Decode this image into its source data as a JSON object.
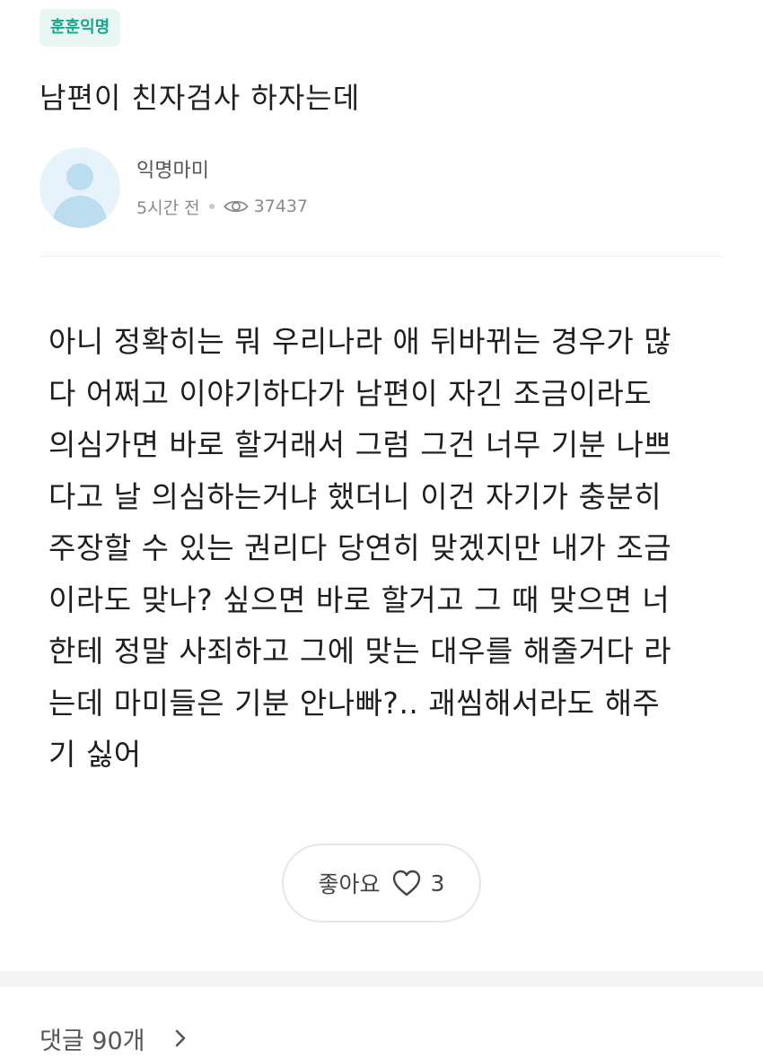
{
  "category": "훈훈익명",
  "post": {
    "title": "남편이 친자검사 하자는데",
    "author": "익명마미",
    "time": "5시간 전",
    "views": "37437",
    "body": "아니 정확히는 뭐 우리나라 애 뒤바뀌는 경우가 많\n다 어쩌고 이야기하다가 남편이 자긴 조금이라도\n의심가면 바로 할거래서 그럼 그건 너무 기분 나쁘\n다고 날 의심하는거냐 했더니 이건 자기가 충분히\n주장할 수 있는 권리다 당연히 맞겠지만 내가 조금\n이라도 맞나? 싶으면 바로 할거고 그 때 맞으면 너\n한테 정말 사죄하고 그에 맞는 대우를 해줄거다 라\n는데 마미들은 기분 안나빠?.. 괘씸해서라도 해주\n기 싫어"
  },
  "like": {
    "label": "좋아요",
    "count": "3"
  },
  "comments": {
    "label": "댓글 90개"
  },
  "icons": {
    "avatar": "default-user-avatar",
    "views": "eye-icon",
    "like": "heart-outline-icon",
    "comments": "chevron-right-icon"
  },
  "colors": {
    "accent": "#19a58a",
    "badge_bg": "#e8f6f3",
    "avatar_bg": "#e6f3fb"
  }
}
